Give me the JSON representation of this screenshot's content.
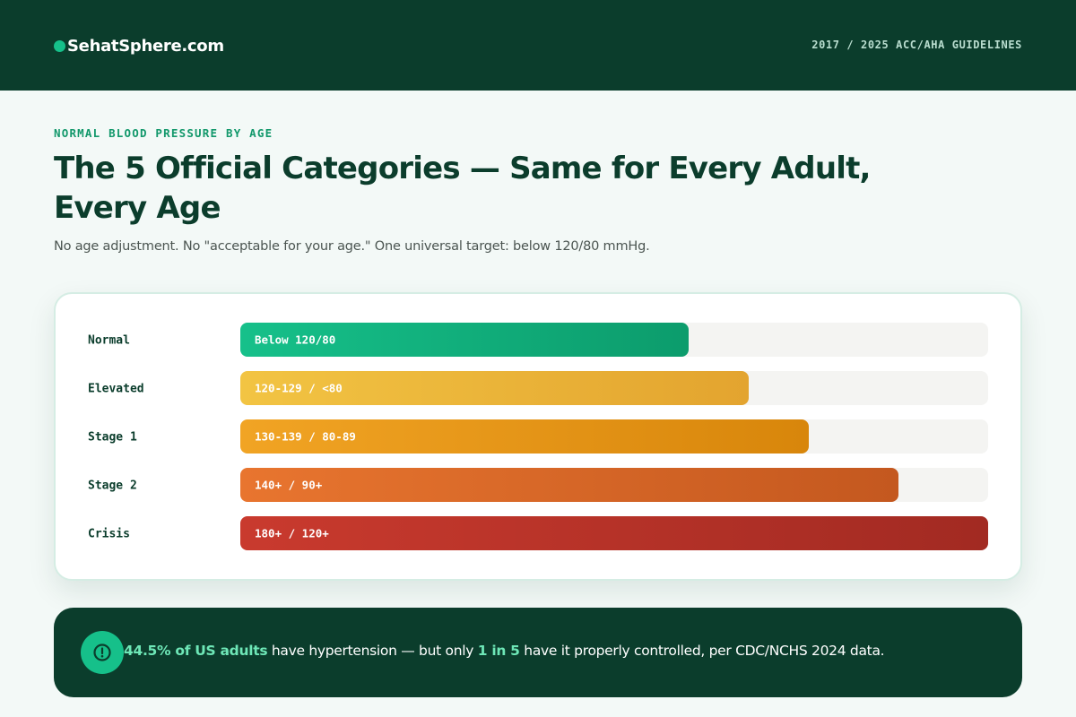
{
  "header": {
    "brand": "SehatSphere.com",
    "guidelines": "2017 / 2025 ACC/AHA GUIDELINES"
  },
  "main": {
    "eyebrow": "NORMAL BLOOD PRESSURE BY AGE",
    "title": "The 5 Official Categories — Same for Every Adult, Every Age",
    "subtitle": "No age adjustment. No \"acceptable for your age.\" One universal target: below 120/80 mmHg."
  },
  "chart_data": {
    "type": "bar",
    "orientation": "horizontal",
    "categories": [
      "Normal",
      "Elevated",
      "Stage 1",
      "Stage 2",
      "Crisis"
    ],
    "bar_labels": [
      "Below 120/80",
      "120-129 / <80",
      "130-139 / 80-89",
      "140+ / 90+",
      "180+ / 120+"
    ],
    "values": [
      0.6,
      0.68,
      0.76,
      0.88,
      1.0
    ],
    "value_unit": "fraction of track filled",
    "grid": false,
    "colors": [
      [
        "#16c08a",
        "#0c9c6c"
      ],
      [
        "#f2c443",
        "#e3a42f"
      ],
      [
        "#f1a424",
        "#d8860b"
      ],
      [
        "#e8752f",
        "#c4581f"
      ],
      [
        "#c93a2e",
        "#a22a22"
      ]
    ],
    "track_color": "#f4f4f2"
  },
  "banner": {
    "icon": "alert-circle-icon",
    "highlight1": "44.5% of US adults",
    "text1": " have hypertension — but only ",
    "highlight2": "1 in 5",
    "text2": " have it properly controlled, per CDC/NCHS 2024 data."
  },
  "colors": {
    "header_bg": "#0b3d2c",
    "accent": "#16c08a",
    "page_bg": "#f3f9f7"
  }
}
